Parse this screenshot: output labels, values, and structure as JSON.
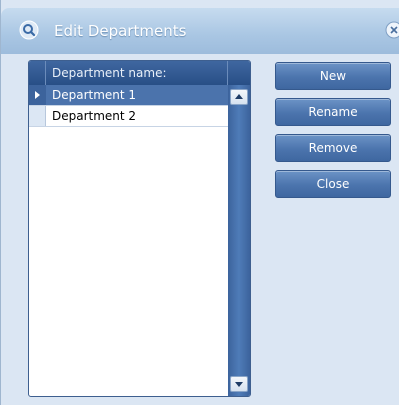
{
  "window": {
    "title": "Edit Departments"
  },
  "grid": {
    "column_header": "Department name:",
    "rows": [
      {
        "name": "Department 1",
        "selected": true
      },
      {
        "name": "Department 2",
        "selected": false
      }
    ]
  },
  "buttons": {
    "new_label": "New",
    "rename_label": "Rename",
    "remove_label": "Remove",
    "close_label": "Close"
  },
  "icons": {
    "title_icon": "magnifier-icon",
    "close_icon": "close-icon",
    "scroll_up": "triangle-up-icon",
    "scroll_down": "triangle-down-icon",
    "row_indicator": "row-arrow-icon"
  },
  "colors": {
    "titlebar": "#a9c6e3",
    "accent": "#4b74ad",
    "selection": "#4b73ac",
    "background": "#dbe6f3"
  }
}
